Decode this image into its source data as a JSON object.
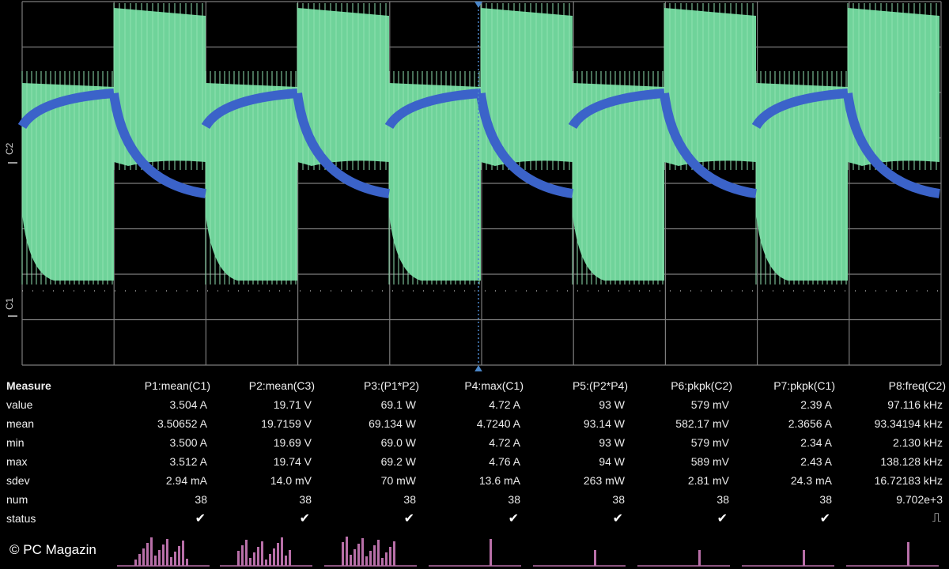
{
  "scope": {
    "channel_labels": [
      "C2",
      "C1"
    ],
    "colors": {
      "green_trace": "#6fd39a",
      "blue_trace": "#3b63c9",
      "grid": "#7c7c7c",
      "background": "#000000",
      "trigger_marker": "#4a86c8",
      "histogram": "#b86fa8"
    }
  },
  "measure": {
    "header_label": "Measure",
    "columns": [
      "P1:mean(C1)",
      "P2:mean(C3)",
      "P3:(P1*P2)",
      "P4:max(C1)",
      "P5:(P2*P4)",
      "P6:pkpk(C2)",
      "P7:pkpk(C1)",
      "P8:freq(C2)"
    ],
    "rows": [
      {
        "label": "value",
        "cells": [
          "3.504 A",
          "19.71 V",
          "69.1 W",
          "4.72 A",
          "93 W",
          "579 mV",
          "2.39 A",
          "97.116 kHz"
        ]
      },
      {
        "label": "mean",
        "cells": [
          "3.50652 A",
          "19.7159 V",
          "69.134 W",
          "4.7240 A",
          "93.14 W",
          "582.17 mV",
          "2.3656 A",
          "93.34194 kHz"
        ]
      },
      {
        "label": "min",
        "cells": [
          "3.500 A",
          "19.69 V",
          "69.0 W",
          "4.72 A",
          "93 W",
          "579 mV",
          "2.34 A",
          "2.130 kHz"
        ]
      },
      {
        "label": "max",
        "cells": [
          "3.512 A",
          "19.74 V",
          "69.2 W",
          "4.76 A",
          "94 W",
          "589 mV",
          "2.43 A",
          "138.128 kHz"
        ]
      },
      {
        "label": "sdev",
        "cells": [
          "2.94 mA",
          "14.0 mV",
          "70 mW",
          "13.6 mA",
          "263 mW",
          "2.81 mV",
          "24.3 mA",
          "16.72183 kHz"
        ]
      },
      {
        "label": "num",
        "cells": [
          "38",
          "38",
          "38",
          "38",
          "38",
          "38",
          "38",
          "9.702e+3"
        ]
      },
      {
        "label": "status",
        "cells": [
          "✔",
          "✔",
          "✔",
          "✔",
          "✔",
          "✔",
          "✔",
          "⎍"
        ]
      }
    ]
  },
  "watermark": "© PC Magazin"
}
